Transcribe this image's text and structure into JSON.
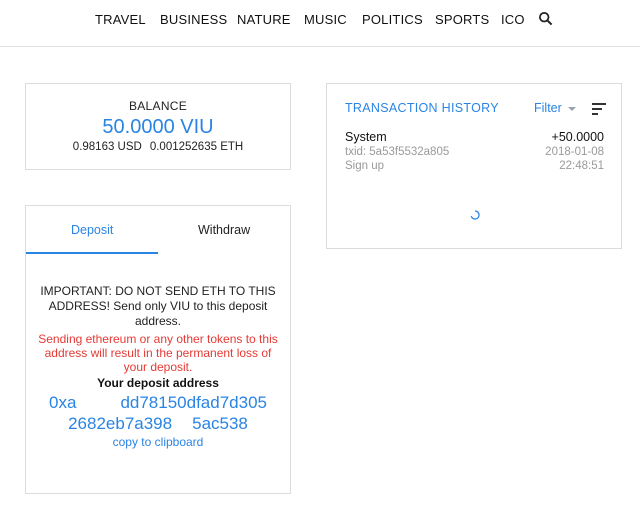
{
  "nav": {
    "items": [
      "TRAVEL",
      "BUSINESS",
      "NATURE",
      "MUSIC",
      "POLITICS",
      "SPORTS",
      "ICO"
    ],
    "search_icon": "search-icon"
  },
  "balance": {
    "heading": "BALANCE",
    "amount": "50.0000 VIU",
    "usd": "0.98163 USD",
    "eth": "0.001252635 ETH"
  },
  "transactions": {
    "title": "TRANSACTION HISTORY",
    "filter_label": "Filter",
    "sort_icon": "sort-icon",
    "rows": [
      {
        "name": "System",
        "amount": "+50.0000",
        "txid": "txid: 5a53f5532a805",
        "date": "2018-01-08",
        "type": "Sign up",
        "time": "22:48:51"
      }
    ],
    "loading_icon": "spinner-icon"
  },
  "deposit": {
    "tabs": [
      "Deposit",
      "Withdraw"
    ],
    "active_tab": "Deposit",
    "important": "IMPORTANT: DO NOT SEND ETH TO THIS ADDRESS! Send only VIU to this deposit address.",
    "warning": "Sending ethereum or any other tokens to this address will result in the permanent loss of your deposit.",
    "address_label": "Your deposit address",
    "address_line1_start": "0xa",
    "address_line1_end": "dd78150dfad7d305",
    "address_line2_start": "2682eb7a398",
    "address_line2_end": "5ac538",
    "copy_label": "copy to clipboard"
  },
  "colors": {
    "accent": "#2a84e4",
    "danger": "#e53a34",
    "muted": "#9a9a9a",
    "border": "#dcdcdc"
  }
}
